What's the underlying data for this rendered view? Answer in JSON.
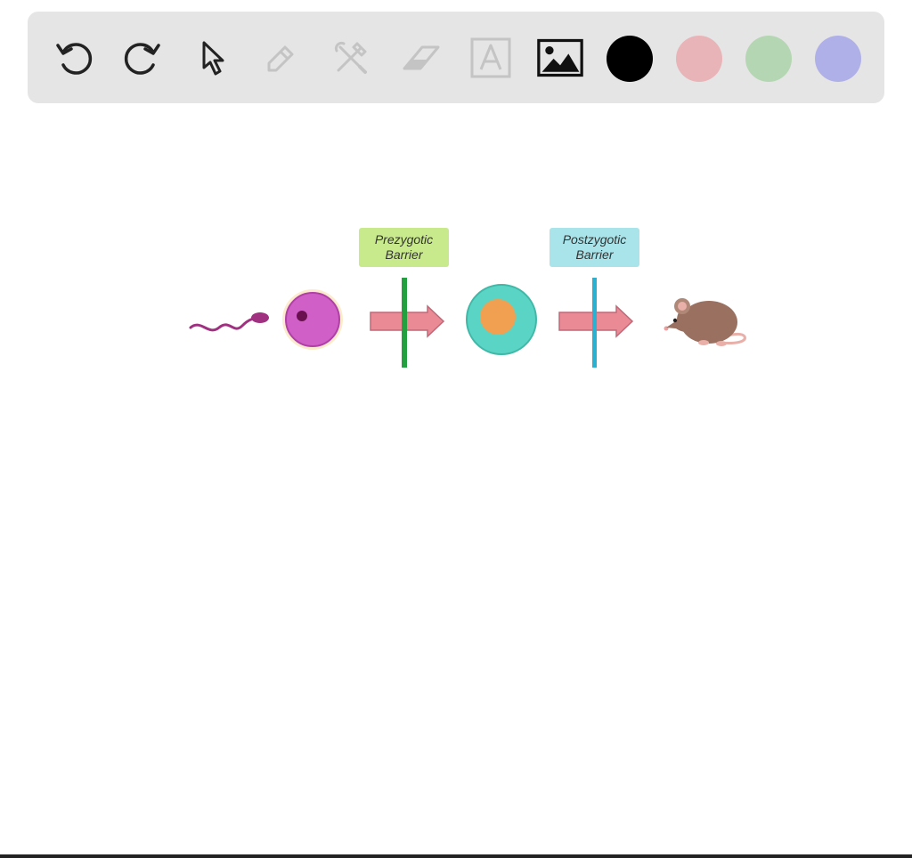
{
  "toolbar": {
    "tools": [
      {
        "name": "undo",
        "icon": "undo-icon",
        "enabled": true
      },
      {
        "name": "redo",
        "icon": "redo-icon",
        "enabled": true
      },
      {
        "name": "select",
        "icon": "pointer-icon",
        "enabled": true
      },
      {
        "name": "pen",
        "icon": "pencil-icon",
        "enabled": false
      },
      {
        "name": "tools",
        "icon": "tools-icon",
        "enabled": false
      },
      {
        "name": "eraser",
        "icon": "eraser-icon",
        "enabled": false
      },
      {
        "name": "text",
        "icon": "text-icon",
        "enabled": false
      },
      {
        "name": "image",
        "icon": "image-icon",
        "enabled": true
      }
    ],
    "colors": [
      "#000000",
      "#e8b4b8",
      "#b5d6b2",
      "#b0b0e8"
    ]
  },
  "diagram": {
    "prezygotic_label_line1": "Prezygotic",
    "prezygotic_label_line2": "Barrier",
    "postzygotic_label_line1": "Postzygotic",
    "postzygotic_label_line2": "Barrier",
    "colors": {
      "prezygotic_bg": "#c9ea8c",
      "postzygotic_bg": "#a8e4ea",
      "prezygotic_bar": "#22a040",
      "postzygotic_bar": "#2ab0d0",
      "arrow": "#e98a95",
      "sperm": "#a03080",
      "egg": "#d060c8",
      "zygote_outer": "#5ad4c4",
      "zygote_inner": "#f0a050",
      "mouse": "#9a7060"
    }
  }
}
